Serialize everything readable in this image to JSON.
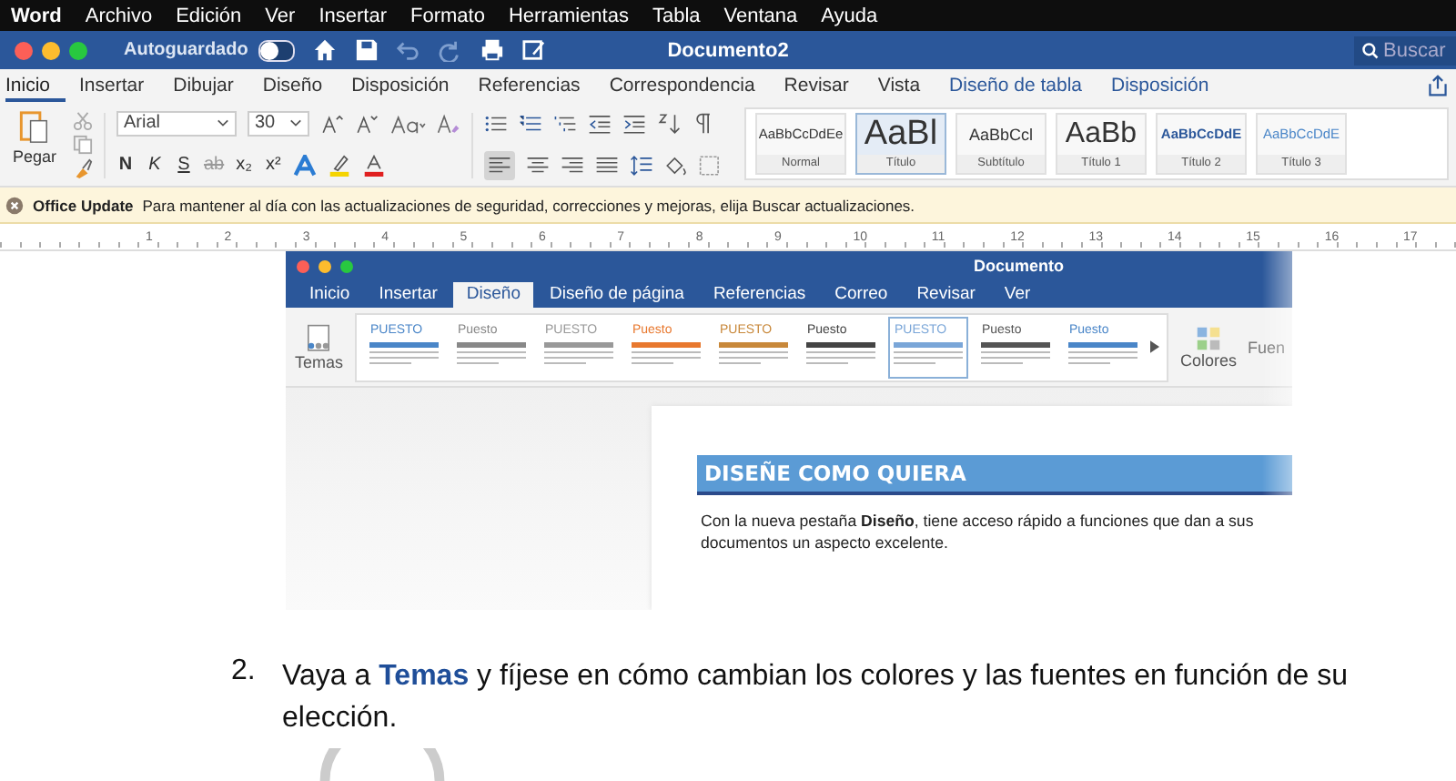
{
  "menu_bar": {
    "app": "Word",
    "items": [
      "Archivo",
      "Edición",
      "Ver",
      "Insertar",
      "Formato",
      "Herramientas",
      "Tabla",
      "Ventana",
      "Ayuda"
    ]
  },
  "title_bar": {
    "autosave_label": "Autoguardado",
    "autosave_on": false,
    "title": "Documento2",
    "search_placeholder": "Buscar"
  },
  "ribbon_tabs": [
    {
      "label": "Inicio",
      "selected": true,
      "contextual": false
    },
    {
      "label": "Insertar",
      "selected": false,
      "contextual": false
    },
    {
      "label": "Dibujar",
      "selected": false,
      "contextual": false
    },
    {
      "label": "Diseño",
      "selected": false,
      "contextual": false
    },
    {
      "label": "Disposición",
      "selected": false,
      "contextual": false
    },
    {
      "label": "Referencias",
      "selected": false,
      "contextual": false
    },
    {
      "label": "Correspondencia",
      "selected": false,
      "contextual": false
    },
    {
      "label": "Revisar",
      "selected": false,
      "contextual": false
    },
    {
      "label": "Vista",
      "selected": false,
      "contextual": false
    },
    {
      "label": "Diseño de tabla",
      "selected": false,
      "contextual": true
    },
    {
      "label": "Disposición",
      "selected": false,
      "contextual": true
    }
  ],
  "ribbon": {
    "paste_label": "Pegar",
    "font": "Arial",
    "size": "30",
    "format_buttons": [
      "N",
      "K",
      "S",
      "ab",
      "x₂",
      "x²"
    ],
    "styles": [
      {
        "preview": "AaBbCcDdEe",
        "name": "Normal",
        "selected": false,
        "kind": "small"
      },
      {
        "preview": "AaBl",
        "name": "Título",
        "selected": true,
        "kind": "huge"
      },
      {
        "preview": "AaBbCcl",
        "name": "Subtítulo",
        "selected": false,
        "kind": "medium"
      },
      {
        "preview": "AaBb",
        "name": "Título 1",
        "selected": false,
        "kind": "large"
      },
      {
        "preview": "AaBbCcDdE",
        "name": "Título 2",
        "selected": false,
        "kind": "bold"
      },
      {
        "preview": "AaBbCcDdE",
        "name": "Título 3",
        "selected": false,
        "kind": "blue"
      }
    ]
  },
  "update_bar": {
    "title": "Office Update",
    "message": "Para mantener al día con las actualizaciones de seguridad, correcciones y mejoras, elija Buscar actualizaciones."
  },
  "ruler": [
    "1",
    "2",
    "3",
    "4",
    "5",
    "6",
    "7",
    "8",
    "9",
    "10",
    "11",
    "12",
    "13",
    "14",
    "15",
    "16",
    "17"
  ],
  "embedded_window": {
    "title": "Documento",
    "tabs": [
      {
        "label": "Inicio",
        "selected": false
      },
      {
        "label": "Insertar",
        "selected": false
      },
      {
        "label": "Diseño",
        "selected": true
      },
      {
        "label": "Diseño de página",
        "selected": false
      },
      {
        "label": "Referencias",
        "selected": false
      },
      {
        "label": "Correo",
        "selected": false
      },
      {
        "label": "Revisar",
        "selected": false
      },
      {
        "label": "Ver",
        "selected": false
      }
    ],
    "themes_label": "Temas",
    "themes": [
      {
        "label": "PUESTO",
        "selected": false,
        "color": "#4a86c8"
      },
      {
        "label": "Puesto",
        "selected": false,
        "color": "#888888"
      },
      {
        "label": "PUESTO",
        "selected": false,
        "color": "#999999"
      },
      {
        "label": "Puesto",
        "selected": false,
        "color": "#e8782e"
      },
      {
        "label": "PUESTO",
        "selected": false,
        "color": "#c8883a"
      },
      {
        "label": "Puesto",
        "selected": false,
        "color": "#444444"
      },
      {
        "label": "PUESTO",
        "selected": true,
        "color": "#7aa6d8"
      },
      {
        "label": "Puesto",
        "selected": false,
        "color": "#555555"
      },
      {
        "label": "Puesto",
        "selected": false,
        "color": "#4a86c8"
      }
    ],
    "colors_label": "Colores",
    "fonts_label": "Fuen",
    "heading": "DISEÑE COMO QUIERA",
    "body": "Con la nueva pestaña **Diseño**, tiene acceso rápido a funciones que dan a sus documentos un aspecto excelente."
  },
  "list_item": {
    "number": "2.",
    "text": "Vaya a **Temas** y fíjese en cómo cambian los colores y las fuentes en función de su elección."
  }
}
